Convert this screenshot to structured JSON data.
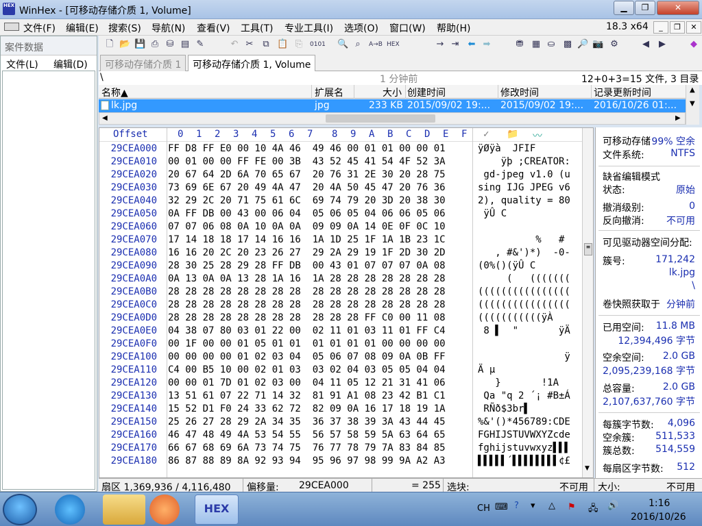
{
  "window": {
    "title": "WinHex - [可移动存储介质 1, Volume]",
    "app_icon": "HEX"
  },
  "menu": [
    "文件(F)",
    "编辑(E)",
    "搜索(S)",
    "导航(N)",
    "查看(V)",
    "工具(T)",
    "专业工具(I)",
    "选项(O)",
    "窗口(W)",
    "帮助(H)"
  ],
  "version": "18.3 x64",
  "case_panel": {
    "title": "案件数据",
    "menu": [
      "文件(L)",
      "编辑(D)"
    ]
  },
  "tabs": [
    "可移动存储介质 1",
    "可移动存储介质 1, Volume"
  ],
  "path": {
    "root": "\\",
    "elapsed": "1 分钟前",
    "summary": "12+0+3=15 文件, 3 目录"
  },
  "file_list": {
    "headers": [
      "名称▲",
      "扩展名",
      "大小",
      "创建时间",
      "修改时间",
      "记录更新时间"
    ],
    "rows": [
      {
        "name": "lk.jpg",
        "ext": "jpg",
        "size": "233 KB",
        "created": "2015/09/02  19:...",
        "modified": "2015/09/02  19:...",
        "updated": "2016/10/26  01:..."
      }
    ]
  },
  "hex": {
    "offset_label": "Offset",
    "columns": [
      "0",
      "1",
      "2",
      "3",
      "4",
      "5",
      "6",
      "7",
      "8",
      "9",
      "A",
      "B",
      "C",
      "D",
      "E",
      "F"
    ],
    "rows": [
      {
        "o": "29CEA000",
        "b": "FF D8 FF E0 00 10 4A 46  49 46 00 01 01 00 00 01",
        "a": "ÿØÿà  JFIF"
      },
      {
        "o": "29CEA010",
        "b": "00 01 00 00 FF FE 00 3B  43 52 45 41 54 4F 52 3A",
        "a": "    ÿþ ;CREATOR:"
      },
      {
        "o": "29CEA020",
        "b": "20 67 64 2D 6A 70 65 67  20 76 31 2E 30 20 28 75",
        "a": " gd-jpeg v1.0 (u"
      },
      {
        "o": "29CEA030",
        "b": "73 69 6E 67 20 49 4A 47  20 4A 50 45 47 20 76 36",
        "a": "sing IJG JPEG v6"
      },
      {
        "o": "29CEA040",
        "b": "32 29 2C 20 71 75 61 6C  69 74 79 20 3D 20 38 30",
        "a": "2), quality = 80"
      },
      {
        "o": "29CEA050",
        "b": "0A FF DB 00 43 00 06 04  05 06 05 04 06 06 05 06",
        "a": " ÿÛ C"
      },
      {
        "o": "29CEA060",
        "b": "07 07 06 08 0A 10 0A 0A  09 09 0A 14 0E 0F 0C 10",
        "a": ""
      },
      {
        "o": "29CEA070",
        "b": "17 14 18 18 17 14 16 16  1A 1D 25 1F 1A 1B 23 1C",
        "a": "          %   #"
      },
      {
        "o": "29CEA080",
        "b": "16 16 20 2C 20 23 26 27  29 2A 29 19 1F 2D 30 2D",
        "a": "   , #&')*)  -0-"
      },
      {
        "o": "29CEA090",
        "b": "28 30 25 28 29 28 FF DB  00 43 01 07 07 07 0A 08",
        "a": "(0%()(ÿÛ C"
      },
      {
        "o": "29CEA0A0",
        "b": "0A 13 0A 0A 13 28 1A 16  1A 28 28 28 28 28 28 28",
        "a": "     (   ((((((("
      },
      {
        "o": "29CEA0B0",
        "b": "28 28 28 28 28 28 28 28  28 28 28 28 28 28 28 28",
        "a": "(((((((((((((((("
      },
      {
        "o": "29CEA0C0",
        "b": "28 28 28 28 28 28 28 28  28 28 28 28 28 28 28 28",
        "a": "(((((((((((((((("
      },
      {
        "o": "29CEA0D0",
        "b": "28 28 28 28 28 28 28 28  28 28 28 FF C0 00 11 08",
        "a": "(((((((((((ÿÀ"
      },
      {
        "o": "29CEA0E0",
        "b": "04 38 07 80 03 01 22 00  02 11 01 03 11 01 FF C4",
        "a": " 8 ▌  \"       ÿÄ"
      },
      {
        "o": "29CEA0F0",
        "b": "00 1F 00 00 01 05 01 01  01 01 01 01 00 00 00 00",
        "a": ""
      },
      {
        "o": "29CEA100",
        "b": "00 00 00 00 01 02 03 04  05 06 07 08 09 0A 0B FF",
        "a": "               ÿ"
      },
      {
        "o": "29CEA110",
        "b": "C4 00 B5 10 00 02 01 03  03 02 04 03 05 05 04 04",
        "a": "Ä µ"
      },
      {
        "o": "29CEA120",
        "b": "00 00 01 7D 01 02 03 00  04 11 05 12 21 31 41 06",
        "a": "   }       !1A"
      },
      {
        "o": "29CEA130",
        "b": "13 51 61 07 22 71 14 32  81 91 A1 08 23 42 B1 C1",
        "a": " Qa \"q 2 ´¡ #B±Á"
      },
      {
        "o": "29CEA140",
        "b": "15 52 D1 F0 24 33 62 72  82 09 0A 16 17 18 19 1A",
        "a": " RÑð$3br▌"
      },
      {
        "o": "29CEA150",
        "b": "25 26 27 28 29 2A 34 35  36 37 38 39 3A 43 44 45",
        "a": "%&'()*456789:CDE"
      },
      {
        "o": "29CEA160",
        "b": "46 47 48 49 4A 53 54 55  56 57 58 59 5A 63 64 65",
        "a": "FGHIJSTUVWXYZcde"
      },
      {
        "o": "29CEA170",
        "b": "66 67 68 69 6A 73 74 75  76 77 78 79 7A 83 84 85",
        "a": "fghijstuvwxyz▌▌▌"
      },
      {
        "o": "29CEA180",
        "b": "86 87 88 89 8A 92 93 94  95 96 97 98 99 9A A2 A3",
        "a": "▌▌▌▌▌´▌▌▌▌▌▌▌▌¢£"
      }
    ]
  },
  "info": {
    "device_label": "可移动存储",
    "free_pct": "99% 空余",
    "fs_label": "文件系统:",
    "fs": "NTFS",
    "edit_mode_title": "缺省编辑模式",
    "state_label": "状态:",
    "state": "原始",
    "undo_label": "撤消级别:",
    "undo": "0",
    "redo_label": "反向撤消:",
    "redo": "不可用",
    "alloc_title": "可见驱动器空间分配:",
    "cluster_label": "簇号:",
    "cluster": "171,242",
    "cluster_file": "lk.jpg",
    "cluster_dir": "\\",
    "snapshot_label": "卷快照获取于",
    "snapshot": "分钟前",
    "used_label": "已用空间:",
    "used": "11.8 MB",
    "used_bytes": "12,394,496 字节",
    "free_label": "空余空间:",
    "free": "2.0 GB",
    "free_bytes": "2,095,239,168 字节",
    "total_label": "总容量:",
    "total": "2.0 GB",
    "total_bytes": "2,107,637,760 字节",
    "bpc_label": "每簇字节数:",
    "bpc": "4,096",
    "freec_label": "空余簇:",
    "freec": "511,533",
    "totalc_label": "簇总数:",
    "totalc": "514,559",
    "bps_label": "每扇区字节数:",
    "bps": "512"
  },
  "status": {
    "sector": "扇区 1,369,936 / 4,116,480",
    "offset_label": "偏移量:",
    "offset": "29CEA000",
    "value": "= 255",
    "block_label": "选块:",
    "block": "不可用",
    "size_label": "大小:",
    "size": "不可用"
  },
  "taskbar": {
    "lang": "CH",
    "time": "1:16",
    "date": "2016/10/26",
    "hex_app": "HEX"
  }
}
